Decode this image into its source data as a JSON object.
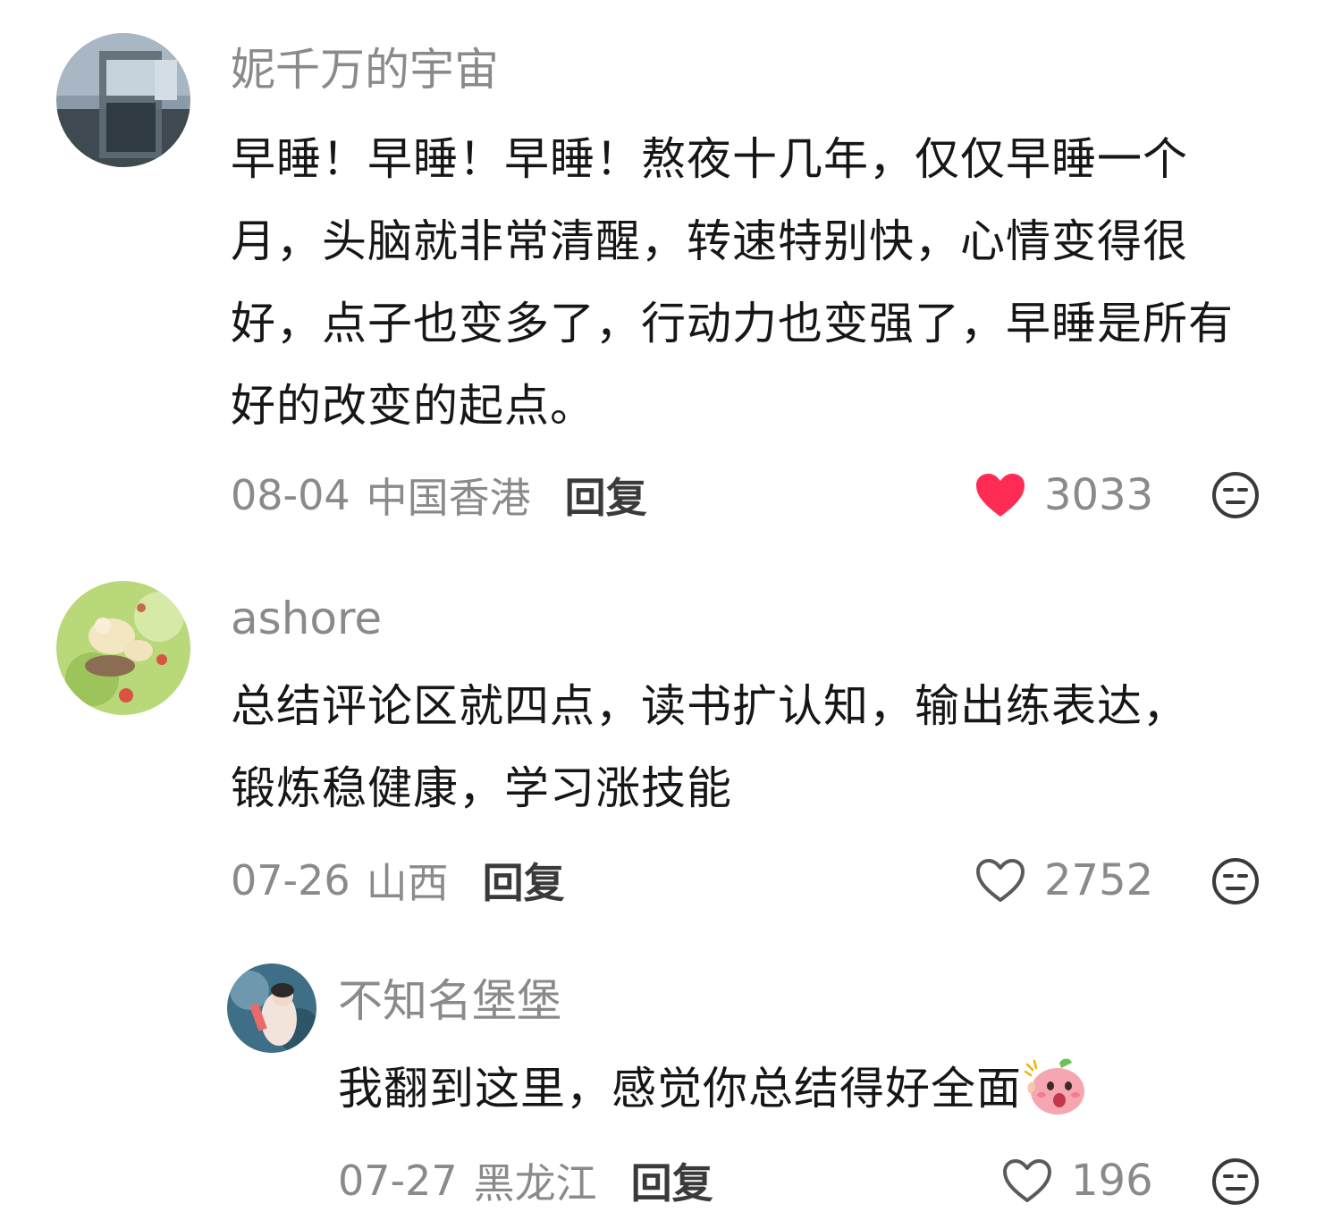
{
  "comments": [
    {
      "username": "妮千万的宇宙",
      "text": "早睡！早睡！早睡！熬夜十几年，仅仅早睡一个月，头脑就非常清醒，转速特别快，心情变得很好，点子也变多了，行动力也变强了，早睡是所有好的改变的起点。",
      "date": "08-04",
      "location": "中国香港",
      "reply_label": "回复",
      "likes": "3033",
      "liked": true
    },
    {
      "username": "ashore",
      "text": "总结评论区就四点，读书扩认知，输出练表达，锻炼稳健康，学习涨技能",
      "date": "07-26",
      "location": "山西",
      "reply_label": "回复",
      "likes": "2752",
      "liked": false
    },
    {
      "username": "不知名堡堡",
      "text": "我翻到这里，感觉你总结得好全面",
      "date": "07-27",
      "location": "黑龙江",
      "reply_label": "回复",
      "likes": "196",
      "liked": false
    }
  ],
  "colors": {
    "like_active": "#fe2c55",
    "secondary_text": "#8a8a8a",
    "primary_text": "#161616"
  }
}
